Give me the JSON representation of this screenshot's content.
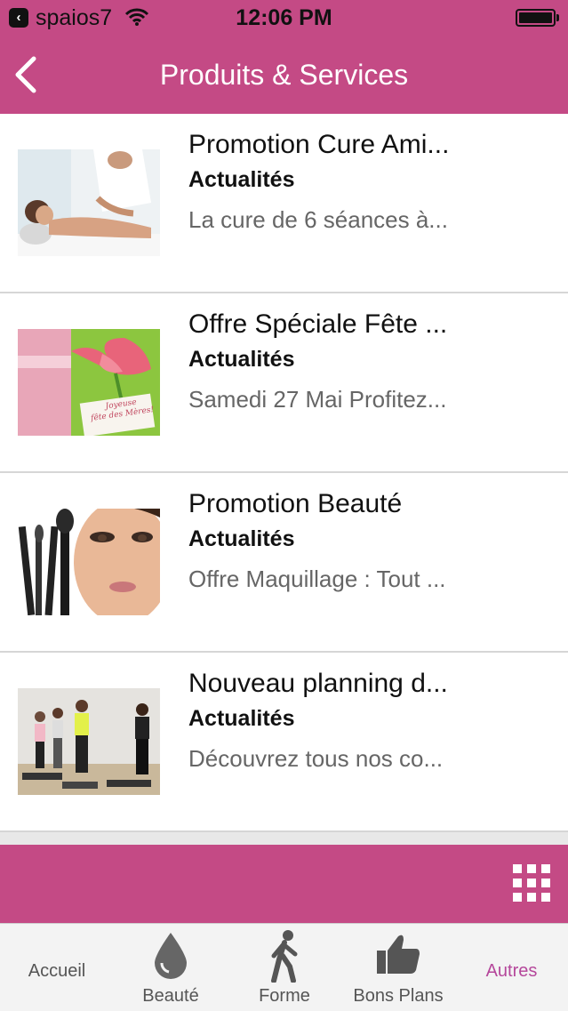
{
  "status_bar": {
    "carrier": "spaios7",
    "time": "12:06 PM"
  },
  "nav": {
    "title": "Produits & Services"
  },
  "items": [
    {
      "title": "Promotion Cure Ami...",
      "category": "Actualités",
      "description": "La cure de 6 séances à..."
    },
    {
      "title": "Offre Spéciale Fête ...",
      "category": "Actualités",
      "description": "Samedi 27 Mai Profitez...",
      "image_text": "Joyeuse\nfête des Mères!"
    },
    {
      "title": "Promotion Beauté",
      "category": "Actualités",
      "description": "Offre Maquillage : Tout ..."
    },
    {
      "title": "Nouveau planning d...",
      "category": "Actualités",
      "description": "Découvrez tous nos co..."
    }
  ],
  "tabs": [
    {
      "label": "Accueil",
      "icon": "none"
    },
    {
      "label": "Beauté",
      "icon": "drop-icon"
    },
    {
      "label": "Forme",
      "icon": "walking-person-icon"
    },
    {
      "label": "Bons Plans",
      "icon": "thumbs-up-icon"
    },
    {
      "label": "Autres",
      "icon": "none",
      "active": true
    }
  ],
  "colors": {
    "brand": "#c44a85",
    "active_tab": "#b5479b"
  }
}
